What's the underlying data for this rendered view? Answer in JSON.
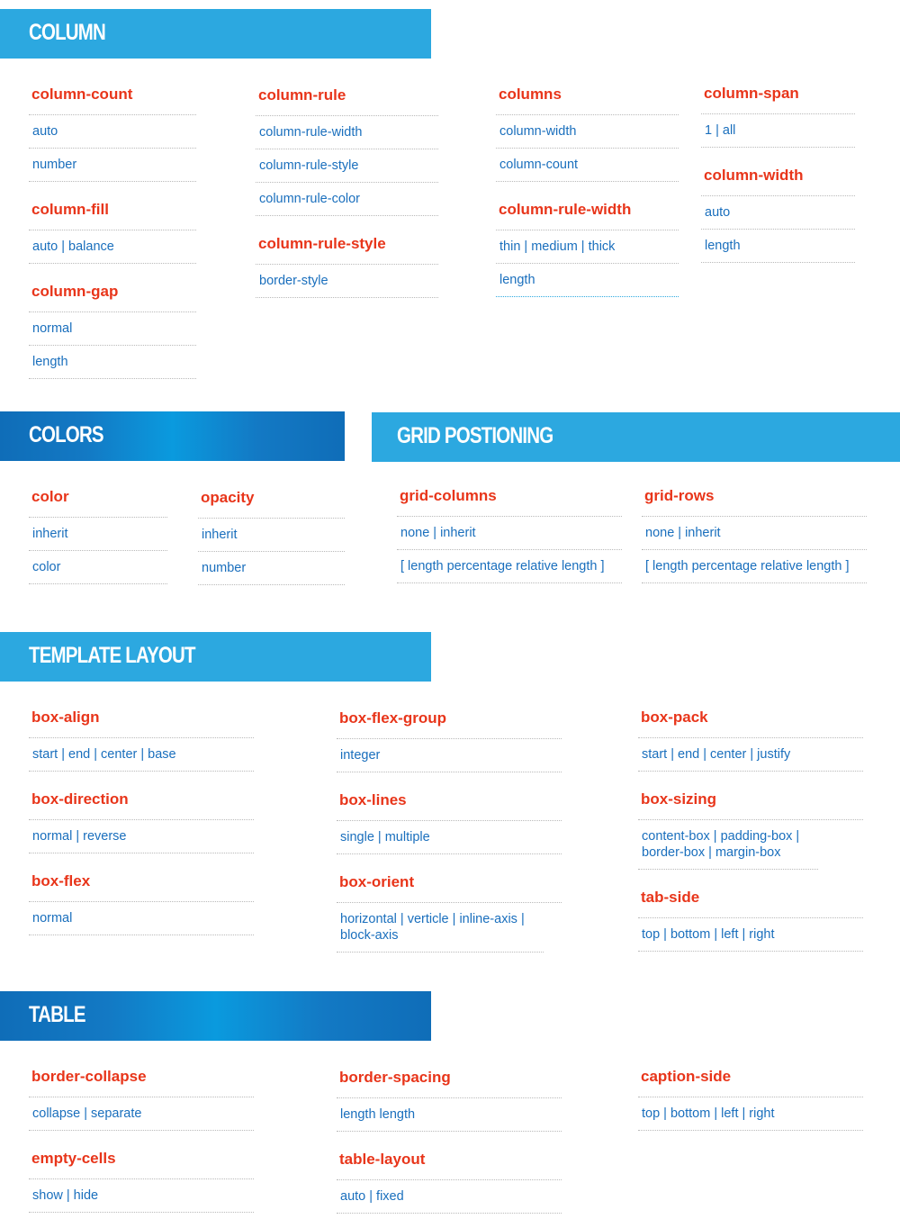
{
  "colors": {
    "header_light": "#2ca8e0",
    "header_dark": "#0f6db8",
    "property_name": "#e8351a",
    "property_value": "#1a6fbd"
  },
  "sections": {
    "column": {
      "title": "COLUMN",
      "groups": [
        [
          {
            "name": "column-count",
            "values": [
              "auto",
              "number"
            ]
          },
          {
            "name": "column-fill",
            "values": [
              "auto | balance"
            ]
          },
          {
            "name": "column-gap",
            "values": [
              "normal",
              "length"
            ]
          }
        ],
        [
          {
            "name": "column-rule",
            "values": [
              "column-rule-width",
              "column-rule-style",
              "column-rule-color"
            ]
          },
          {
            "name": "column-rule-style",
            "values": [
              "border-style"
            ]
          }
        ],
        [
          {
            "name": "columns",
            "values": [
              "column-width",
              "column-count"
            ]
          },
          {
            "name": "column-rule-width",
            "values": [
              "thin | medium | thick",
              "length"
            ]
          }
        ],
        [
          {
            "name": "column-span",
            "values": [
              "1 | all"
            ]
          },
          {
            "name": "column-width",
            "values": [
              "auto",
              "length"
            ]
          }
        ]
      ]
    },
    "colors": {
      "title": "COLORS",
      "groups": [
        [
          {
            "name": "color",
            "values": [
              "inherit",
              "color"
            ]
          }
        ],
        [
          {
            "name": "opacity",
            "values": [
              "inherit",
              "number"
            ]
          }
        ]
      ]
    },
    "grid": {
      "title": "GRID POSTIONING",
      "groups": [
        [
          {
            "name": "grid-columns",
            "values": [
              "none | inherit",
              "[ length percentage relative length ]"
            ]
          }
        ],
        [
          {
            "name": "grid-rows",
            "values": [
              "none | inherit",
              "[ length percentage relative length ]"
            ]
          }
        ]
      ]
    },
    "template": {
      "title": "TEMPLATE LAYOUT",
      "groups": [
        [
          {
            "name": "box-align",
            "values": [
              "start | end | center | base"
            ]
          },
          {
            "name": "box-direction",
            "values": [
              "normal | reverse"
            ]
          },
          {
            "name": "box-flex",
            "values": [
              "normal"
            ]
          }
        ],
        [
          {
            "name": "box-flex-group",
            "values": [
              "integer"
            ]
          },
          {
            "name": "box-lines",
            "values": [
              "single | multiple"
            ]
          },
          {
            "name": "box-orient",
            "values": [
              "horizontal | verticle | inline-axis | block-axis"
            ]
          }
        ],
        [
          {
            "name": "box-pack",
            "values": [
              "start | end | center | justify"
            ]
          },
          {
            "name": "box-sizing",
            "values": [
              "content-box | padding-box | border-box | margin-box"
            ]
          },
          {
            "name": "tab-side",
            "values": [
              "top | bottom | left | right"
            ]
          }
        ]
      ]
    },
    "table": {
      "title": "TABLE",
      "groups": [
        [
          {
            "name": "border-collapse",
            "values": [
              "collapse | separate"
            ]
          },
          {
            "name": "empty-cells",
            "values": [
              "show | hide"
            ]
          }
        ],
        [
          {
            "name": "border-spacing",
            "values": [
              "length length"
            ]
          },
          {
            "name": "table-layout",
            "values": [
              "auto | fixed"
            ]
          }
        ],
        [
          {
            "name": "caption-side",
            "values": [
              "top | bottom | left | right"
            ]
          }
        ]
      ]
    }
  }
}
